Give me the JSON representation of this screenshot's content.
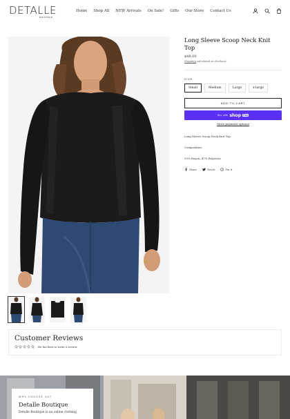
{
  "header": {
    "logo": "DETALLE",
    "logo_sub": "boutique",
    "nav": [
      "Home",
      "Shop All",
      "NEW Arrivals",
      "On Sale!",
      "Gifts",
      "Our Store",
      "Contact Us"
    ],
    "icons": [
      "user-icon",
      "search-icon",
      "cart-icon"
    ]
  },
  "product": {
    "title": "Long Sleeve Scoop Neck Knit Top",
    "price": "$48.00",
    "shipping_prefix": "Shipping",
    "shipping_suffix": "calculated at checkout.",
    "size_label": "SIZE",
    "sizes": [
      "Small",
      "Medium",
      "Large",
      "x-large"
    ],
    "selected_size": "Small",
    "add_to_cart": "ADD TO CART",
    "buy_with": "Buy with",
    "shop_pay_shop": "shop",
    "shop_pay_pay": "Pay",
    "more_payment": "More payment options",
    "description": "Long Sleeve Scoop Neck Knit Top",
    "composition": "Composition:",
    "material": "53% Rayon, 47% Polyester",
    "share": [
      "Share",
      "Tweet",
      "Pin it"
    ]
  },
  "reviews": {
    "title": "Customer Reviews",
    "cta": "Be the first to write a review"
  },
  "banner": {
    "kicker": "WHY CHOOSE US?",
    "title": "Detalle Boutique",
    "text": "Detalle Boutique is an online clothing"
  },
  "colors": {
    "shop_pay": "#5a31f4",
    "text": "#1a1a1a"
  }
}
